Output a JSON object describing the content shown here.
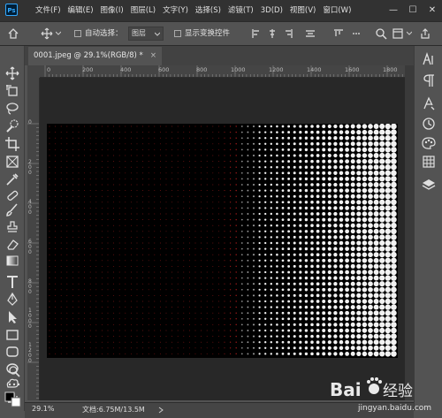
{
  "app": {
    "logo_text": "Ps",
    "menu": [
      "文件(F)",
      "编辑(E)",
      "图像(I)",
      "图层(L)",
      "文字(Y)",
      "选择(S)",
      "滤镜(T)",
      "3D(D)",
      "视图(V)",
      "窗口(W)"
    ],
    "window_controls": [
      "—",
      "☐",
      "✕"
    ]
  },
  "options": {
    "auto_select_label": "自动选择：",
    "auto_select_target": "图层",
    "show_transform_label": "显示变换控件"
  },
  "document": {
    "tab_title": "0001.jpeg @ 29.1%(RGB/8) *",
    "close_glyph": "×"
  },
  "rulers": {
    "top": [
      "0",
      "200",
      "400",
      "600",
      "800",
      "1000",
      "1200",
      "1400",
      "1600",
      "1800"
    ],
    "left": [
      "0",
      "2 0 0",
      "4 0 0",
      "6 0 0",
      "8 0 0",
      "1 0 0 0",
      "1 2 0 0"
    ]
  },
  "status": {
    "zoom": "29.1%",
    "doc_size": "文档:6.75M/13.5M"
  },
  "watermark": {
    "brand": "Bai",
    "brand_tail": "经验",
    "url": "jingyan.baidu.com"
  },
  "colors": {
    "accent": "#31a8ff",
    "dot_red": "#ff2a2a",
    "dot_white": "#ffffff",
    "canvas_bg": "#000000"
  }
}
